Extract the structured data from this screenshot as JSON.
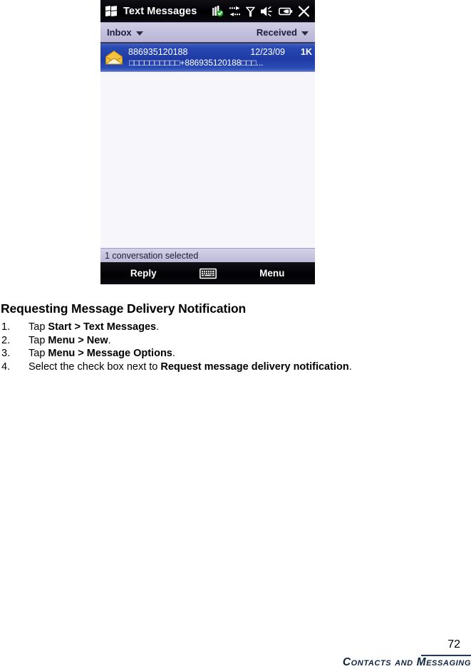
{
  "device": {
    "titlebar": {
      "logo_icon": "windows-flag-icon",
      "title": "Text Messages",
      "status_icons": [
        {
          "name": "signal-strength-icon",
          "label": "Signal strength"
        },
        {
          "name": "data-connection-icon",
          "label": "Data connection"
        },
        {
          "name": "no-network-icon",
          "label": "Network antenna"
        },
        {
          "name": "volume-speaker-icon",
          "label": "Volume"
        },
        {
          "name": "battery-icon",
          "label": "Battery"
        },
        {
          "name": "close-icon",
          "label": "Close"
        }
      ]
    },
    "filterbar": {
      "folder_label": "Inbox",
      "folder_caret_icon": "chevron-down-icon",
      "sort_label": "Received",
      "sort_caret_icon": "chevron-down-icon"
    },
    "message_list": {
      "rows": [
        {
          "icon": "open-envelope-icon",
          "sender": "886935120188",
          "date": "12/23/09",
          "size": "1K",
          "preview": "□□□□□□□□□□+886935120188□□□...",
          "selected": true
        }
      ]
    },
    "statusbar": {
      "text": "1 conversation selected"
    },
    "softkeys": {
      "left_label": "Reply",
      "sip_icon": "keyboard-icon",
      "right_label": "Menu"
    },
    "colors": {
      "titlebar_bg": "#000004",
      "filterbar_bg": "#c3c0dc",
      "selection_blue": "#1f3ba6",
      "list_bg": "#f7f6fa",
      "statusbar_bg": "#c6c3de"
    }
  },
  "document": {
    "heading": "Requesting Message Delivery Notification",
    "steps": [
      {
        "number": "1.",
        "parts": [
          {
            "text": "Tap ",
            "bold": false
          },
          {
            "text": "Start > Text Messages",
            "bold": true
          },
          {
            "text": ".",
            "bold": false
          }
        ]
      },
      {
        "number": "2.",
        "parts": [
          {
            "text": "Tap ",
            "bold": false
          },
          {
            "text": "Menu > New",
            "bold": true
          },
          {
            "text": ".",
            "bold": false
          }
        ]
      },
      {
        "number": "3.",
        "parts": [
          {
            "text": "Tap ",
            "bold": false
          },
          {
            "text": "Menu > Message Options",
            "bold": true
          },
          {
            "text": ".",
            "bold": false
          }
        ]
      },
      {
        "number": "4.",
        "parts": [
          {
            "text": "Select the check box next to ",
            "bold": false
          },
          {
            "text": "Request message delivery notification",
            "bold": true
          },
          {
            "text": ".",
            "bold": false
          }
        ]
      }
    ]
  },
  "footer": {
    "page_number": "72",
    "chapter_title": "Contacts and Messaging",
    "rule_color": "#1f3864"
  }
}
